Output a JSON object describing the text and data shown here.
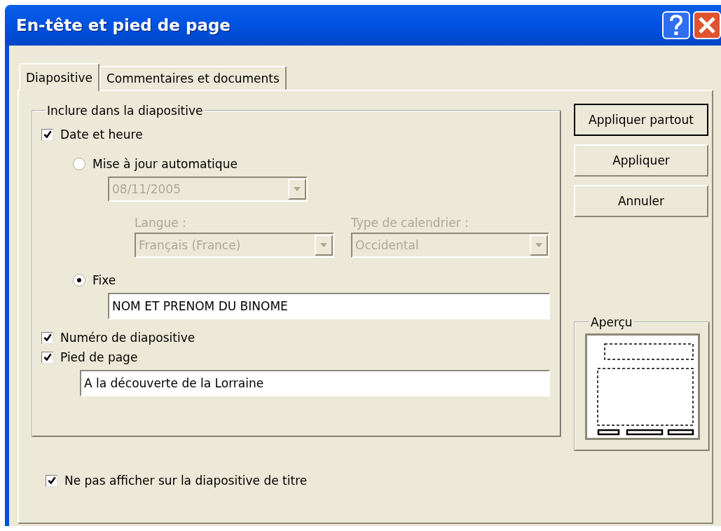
{
  "window": {
    "title": "En-tête et pied de page"
  },
  "tabs": [
    {
      "label": "Diapositive",
      "selected": true
    },
    {
      "label": "Commentaires et documents",
      "selected": false
    }
  ],
  "group": {
    "title": "Inclure dans la diapositive",
    "date_time": {
      "label": "Date et heure",
      "checked": true
    },
    "auto_update": {
      "label": "Mise à jour automatique",
      "selected": false
    },
    "date_dropdown": {
      "value": "08/11/2005",
      "disabled": true
    },
    "language": {
      "label": "Langue :",
      "value": "Français (France)",
      "disabled": true
    },
    "calendar": {
      "label": "Type de calendrier :",
      "value": "Occidental",
      "disabled": true
    },
    "fixed": {
      "label": "Fixe",
      "selected": true
    },
    "fixed_input": {
      "value": "NOM ET PRENOM DU BINOME"
    },
    "slide_number": {
      "label": "Numéro de diapositive",
      "checked": true
    },
    "footer": {
      "label": "Pied de page",
      "checked": true
    },
    "footer_input": {
      "value": "A la découverte de la Lorraine"
    }
  },
  "dont_show_on_title": {
    "label": "Ne pas afficher sur la diapositive de titre",
    "checked": true
  },
  "buttons": [
    {
      "label": "Appliquer partout",
      "default": true
    },
    {
      "label": "Appliquer",
      "default": false
    },
    {
      "label": "Annuler",
      "default": false
    }
  ],
  "preview": {
    "title": "Aperçu"
  }
}
